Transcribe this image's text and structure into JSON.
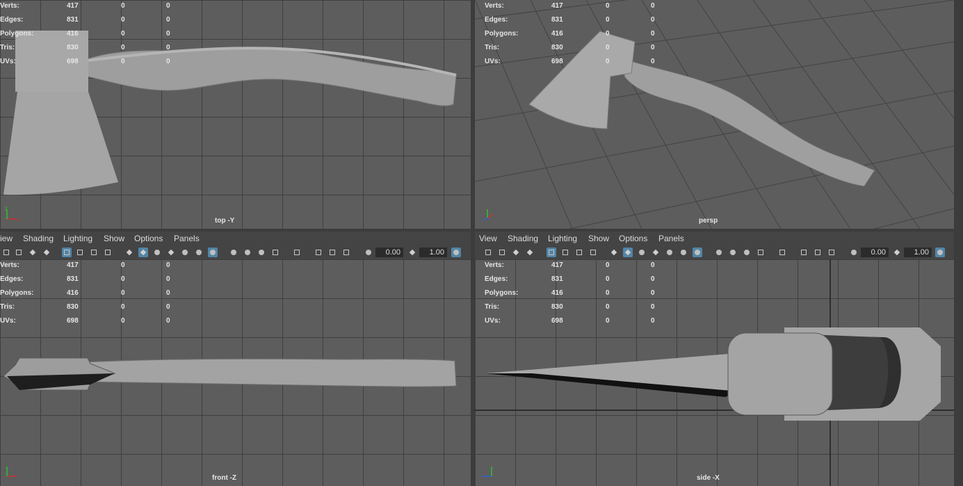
{
  "hud": {
    "rows": [
      {
        "label": "Verts:",
        "v1": "417",
        "v2": "0",
        "v3": "0"
      },
      {
        "label": "Edges:",
        "v1": "831",
        "v2": "0",
        "v3": "0"
      },
      {
        "label": "Polygons:",
        "v1": "416",
        "v2": "0",
        "v3": "0"
      },
      {
        "label": "Tris:",
        "v1": "830",
        "v2": "0",
        "v3": "0"
      },
      {
        "label": "UVs:",
        "v1": "698",
        "v2": "0",
        "v3": "0"
      }
    ]
  },
  "viewports": {
    "top_left": {
      "camera": "top -Y"
    },
    "top_right": {
      "camera": "persp"
    },
    "bottom_left": {
      "camera": "front -Z"
    },
    "bottom_right": {
      "camera": "side -X"
    }
  },
  "panel_menu_left": {
    "view": "iew",
    "shading": "Shading",
    "lighting": "Lighting",
    "show": "Show",
    "options": "Options",
    "panels": "Panels"
  },
  "panel_menu_right": {
    "view": "View",
    "shading": "Shading",
    "lighting": "Lighting",
    "show": "Show",
    "options": "Options",
    "panels": "Panels"
  },
  "panel_fields": {
    "exposure": "0.00",
    "gamma": "1.00"
  },
  "colors": {
    "viewport_bg": "#5d5d5d",
    "grid": "#3f3f3f",
    "mesh": "#a7a7a7",
    "selected_icon": "#5285a6"
  },
  "axis_labels": {
    "x": "x",
    "y": "y",
    "z": "z"
  }
}
